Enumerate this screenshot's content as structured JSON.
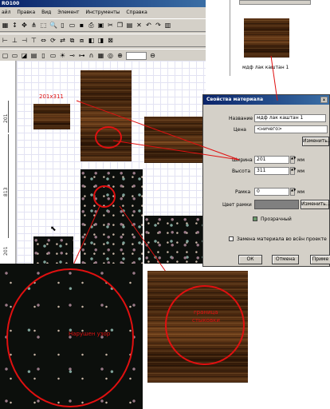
{
  "app": {
    "title": "RO100",
    "menu": [
      "айл",
      "Правка",
      "Вид",
      "Элемент",
      "Инструменты",
      "Справка"
    ],
    "zoom_value": ""
  },
  "ruler": {
    "dim_top": "201",
    "dim_middle": "813",
    "dim_bottom": "201"
  },
  "canvas": {
    "size_label": "201x311"
  },
  "preview": {
    "tab_label": "",
    "material_name": "мдф лак каштан 1"
  },
  "dialog": {
    "title": "Свойства материала",
    "name_label": "Название",
    "name_value": "мдф лак каштан 1",
    "price_label": "Цена",
    "price_value": "<ничего>",
    "change_label": "Изменить...",
    "width_label": "Ширина",
    "width_value": "201",
    "height_label": "Высота",
    "height_value": "311",
    "unit_mm": "мм",
    "frame_label": "Рамка",
    "frame_value": "0",
    "frame_color_label": "Цвет рамки",
    "change_label2": "Изменить...",
    "transparent_label": "Прозрачный",
    "replace_label": "Замена материала во всён проекте",
    "ok_label": "ОК",
    "cancel_label": "Отмена",
    "apply_label": "Приме"
  },
  "annotations": {
    "left_zoom_text": "Нарушен узор",
    "right_zoom_text_1": "граница",
    "right_zoom_text_2": "стыковки"
  },
  "colors": {
    "annotation_red": "#e01010",
    "window_title_blue": "#0a246a"
  }
}
